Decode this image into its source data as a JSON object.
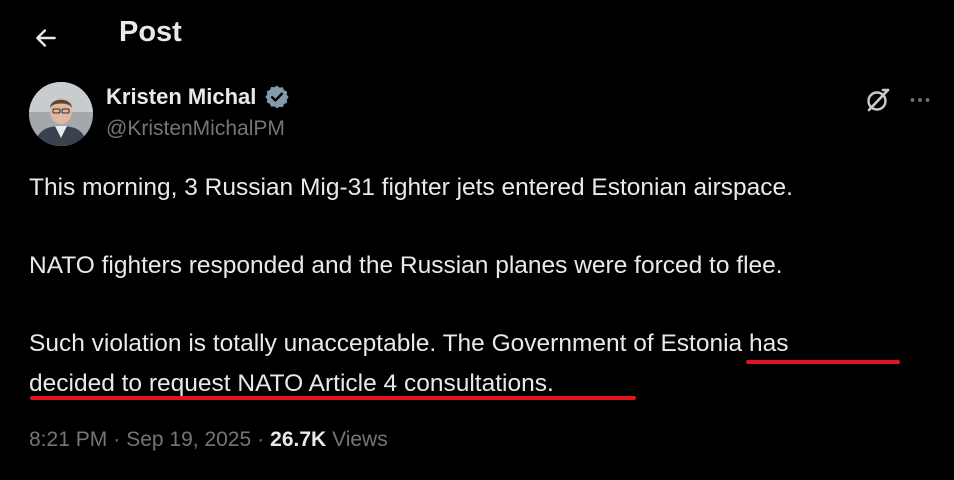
{
  "header": {
    "title": "Post",
    "back_icon": "arrow-left-icon"
  },
  "author": {
    "name": "Kristen Michal",
    "handle": "@KristenMichalPM",
    "verified_icon": "verified-badge-icon"
  },
  "actions": {
    "grok_icon": "grok-icon",
    "more_icon": "more-horizontal-icon"
  },
  "tweet": {
    "paragraph_1": "This morning, 3 Russian Mig-31 fighter jets entered Estonian airspace.",
    "paragraph_2": "NATO fighters responded and the Russian planes were forced to flee.",
    "paragraph_3_line_1": "Such violation is totally unacceptable. The Government of Estonia has",
    "paragraph_3_line_2": "decided to request NATO Article 4 consultations."
  },
  "meta": {
    "time": "8:21 PM",
    "date": "Sep 19, 2025",
    "views_count": "26.7K",
    "views_label": "Views"
  },
  "colors": {
    "background": "#000000",
    "text_primary": "#e7e9ea",
    "text_secondary": "#71767b",
    "verified": "#829aab",
    "annotation_underline": "#e2141c"
  }
}
